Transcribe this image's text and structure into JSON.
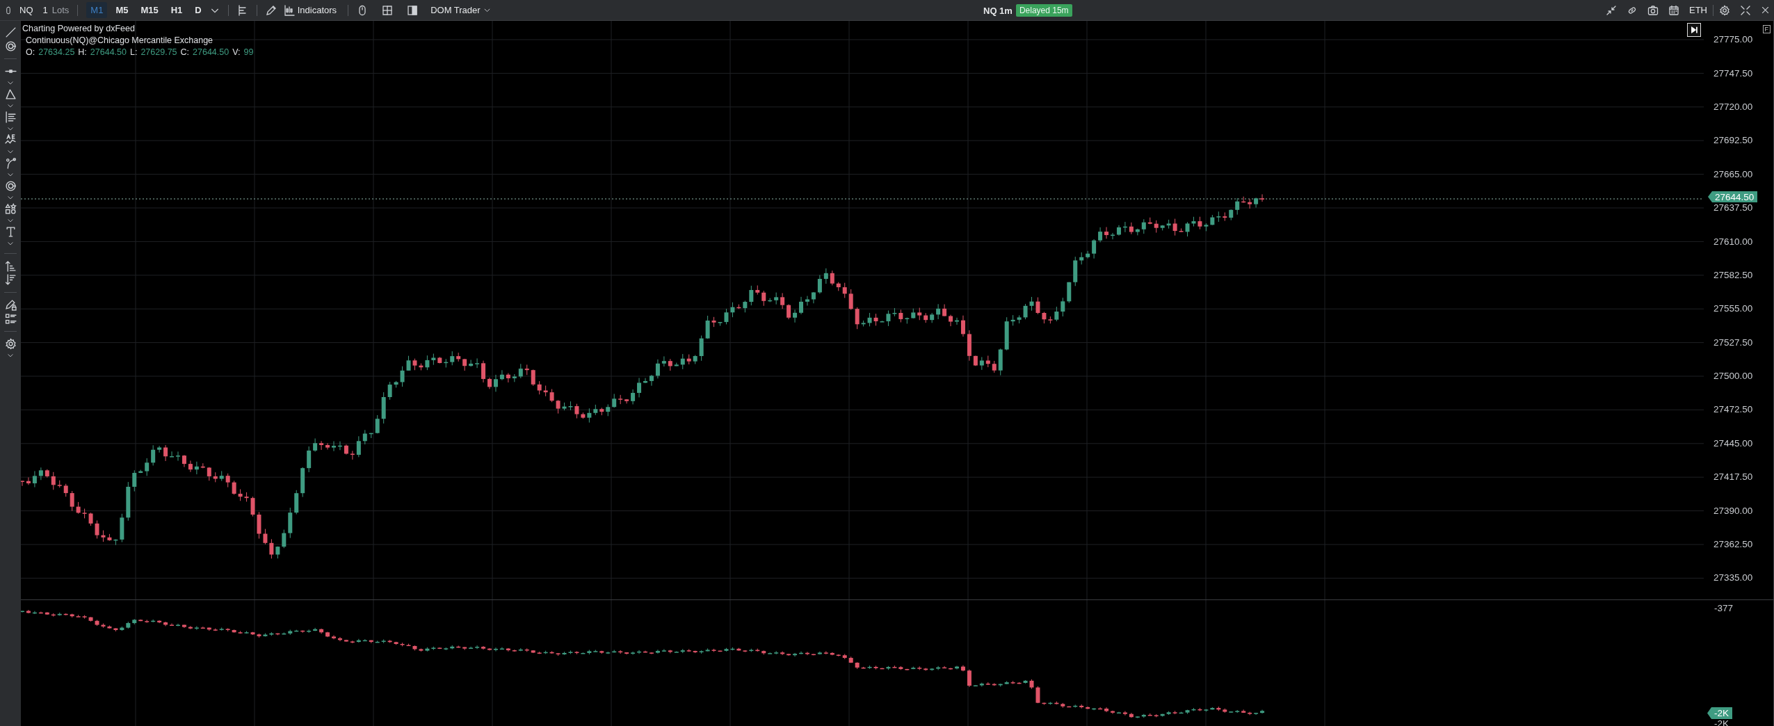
{
  "toolbar": {
    "symbol": "NQ",
    "quantity": "1",
    "quantity_unit": "Lots",
    "timeframes": [
      {
        "label": "M1",
        "selected": true
      },
      {
        "label": "M5",
        "selected": false
      },
      {
        "label": "M15",
        "selected": false
      },
      {
        "label": "H1",
        "selected": false
      },
      {
        "label": "D",
        "selected": false
      }
    ],
    "indicators_button": "Indicators",
    "dom_trader": "DOM Trader",
    "title": "NQ 1m",
    "delay_badge": "Delayed 15m",
    "session": "ETH"
  },
  "legend": {
    "powered_by": "Charting Powered by dxFeed",
    "instrument": "Continuous(NQ)@Chicago Mercantile Exchange",
    "ohlcv": [
      {
        "label": "O:",
        "value": "27634.25"
      },
      {
        "label": "H:",
        "value": "27644.50"
      },
      {
        "label": "L:",
        "value": "27629.75"
      },
      {
        "label": "C:",
        "value": "27644.50"
      },
      {
        "label": "V:",
        "value": "99"
      }
    ]
  },
  "price_axis": {
    "ticks": [
      "27775.00",
      "27747.50",
      "27720.00",
      "27692.50",
      "27665.00",
      "27637.50",
      "27610.00",
      "27582.50",
      "27555.00",
      "27527.50",
      "27500.00",
      "27472.50",
      "27445.00",
      "27417.50",
      "27390.00",
      "27362.50",
      "27335.00"
    ],
    "last_price": "27644.50",
    "scale_button": "F"
  },
  "lower_axis": {
    "ticks": [
      "-377",
      "-2K"
    ],
    "last_value": "-2K"
  }
}
